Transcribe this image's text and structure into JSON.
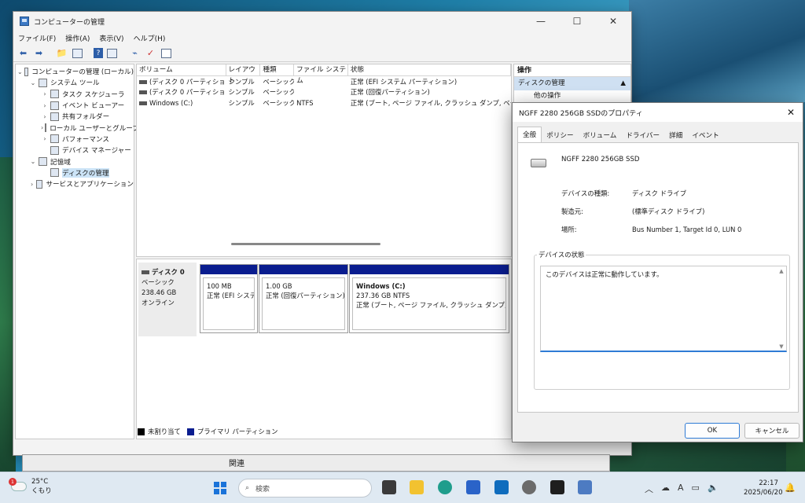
{
  "mmc": {
    "title": "コンピューターの管理",
    "menu": [
      "ファイル(F)",
      "操作(A)",
      "表示(V)",
      "ヘルプ(H)"
    ],
    "tree": [
      {
        "label": "コンピューターの管理 (ローカル)",
        "depth": 0,
        "exp": "⌄"
      },
      {
        "label": "システム ツール",
        "depth": 1,
        "exp": "⌄"
      },
      {
        "label": "タスク スケジューラ",
        "depth": 2,
        "exp": "›"
      },
      {
        "label": "イベント ビューアー",
        "depth": 2,
        "exp": "›"
      },
      {
        "label": "共有フォルダー",
        "depth": 2,
        "exp": "›"
      },
      {
        "label": "ローカル ユーザーとグループ",
        "depth": 2,
        "exp": "›"
      },
      {
        "label": "パフォーマンス",
        "depth": 2,
        "exp": "›"
      },
      {
        "label": "デバイス マネージャー",
        "depth": 2,
        "exp": ""
      },
      {
        "label": "記憶域",
        "depth": 1,
        "exp": "⌄"
      },
      {
        "label": "ディスクの管理",
        "depth": 2,
        "exp": "",
        "selected": true
      },
      {
        "label": "サービスとアプリケーション",
        "depth": 1,
        "exp": "›"
      }
    ],
    "volumes": {
      "headers": [
        "ボリューム",
        "レイアウト",
        "種類",
        "ファイル システム",
        "状態"
      ],
      "rows": [
        [
          "(ディスク 0 パーティション 1)",
          "シンプル",
          "ベーシック",
          "",
          "正常 (EFI システム パーティション)"
        ],
        [
          "(ディスク 0 パーティション 3)",
          "シンプル",
          "ベーシック",
          "",
          "正常 (回復パーティション)"
        ],
        [
          "Windows (C:)",
          "シンプル",
          "ベーシック",
          "NTFS",
          "正常 (ブート, ページ ファイル, クラッシュ ダンプ, ベーシック デ"
        ]
      ]
    },
    "disk": {
      "name": "ディスク 0",
      "type": "ベーシック",
      "size": "238.46 GB",
      "status": "オンライン",
      "partitions": [
        {
          "title": "",
          "size": "100 MB",
          "status": "正常 (EFI システム"
        },
        {
          "title": "",
          "size": "1.00 GB",
          "status": "正常 (回復パーティション)"
        },
        {
          "title": "Windows  (C:)",
          "size": "237.36 GB NTFS",
          "status": "正常 (ブート, ページ ファイル, クラッシュ ダンプ, ベーシック"
        }
      ]
    },
    "legend": {
      "unallocated": "未割り当て",
      "primary": "プライマリ パーティション",
      "unallocated_color": "#000000",
      "primary_color": "#0a1d8f"
    },
    "actions": {
      "header": "操作",
      "sub": "ディスクの管理",
      "item": "他の操作"
    }
  },
  "backwin": {
    "label": "関連"
  },
  "dialog": {
    "title": "NGFF 2280 256GB SSDのプロパティ",
    "tabs": [
      "全般",
      "ポリシー",
      "ボリューム",
      "ドライバー",
      "詳細",
      "イベント"
    ],
    "device_name": "NGFF 2280 256GB SSD",
    "props": [
      {
        "k": "デバイスの種類:",
        "v": "ディスク ドライブ"
      },
      {
        "k": "製造元:",
        "v": "(標準ディスク ドライブ)"
      },
      {
        "k": "場所:",
        "v": "Bus Number 1, Target Id 0, LUN 0"
      }
    ],
    "status_group": "デバイスの状態",
    "status_text": "このデバイスは正常に動作しています。",
    "ok": "OK",
    "cancel": "キャンセル"
  },
  "taskbar": {
    "temp": "25°C",
    "weather": "くもり",
    "badge": "1",
    "search_placeholder": "検索",
    "time": "22:17",
    "date": "2025/06/20",
    "accent": "#1a73d9"
  }
}
